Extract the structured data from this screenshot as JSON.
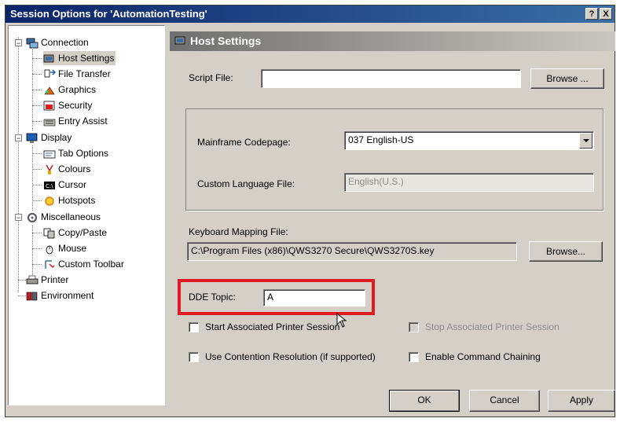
{
  "window": {
    "title": "Session Options for 'AutomationTesting'",
    "help_label": "?",
    "close_label": "X"
  },
  "tree": {
    "connection": "Connection",
    "host_settings": "Host Settings",
    "file_transfer": "File Transfer",
    "graphics": "Graphics",
    "security": "Security",
    "entry_assist": "Entry Assist",
    "display": "Display",
    "tab_options": "Tab Options",
    "colours": "Colours",
    "cursor": "Cursor",
    "hotspots": "Hotspots",
    "miscellaneous": "Miscellaneous",
    "copy_paste": "Copy/Paste",
    "mouse": "Mouse",
    "custom_toolbar": "Custom Toolbar",
    "printer": "Printer",
    "environment": "Environment"
  },
  "panel": {
    "title": "Host Settings",
    "script_file_label": "Script File:",
    "script_file_value": "",
    "browse1_label": "Browse ...",
    "mainframe_codepage_label": "Mainframe Codepage:",
    "mainframe_codepage_value": "037 English-US",
    "custom_language_label": "Custom Language File:",
    "custom_language_value": "English(U.S.)",
    "keyboard_mapping_label": "Keyboard Mapping File:",
    "keyboard_mapping_value": "C:\\Program Files (x86)\\QWS3270 Secure\\QWS3270S.key",
    "browse2_label": "Browse...",
    "dde_topic_label": "DDE Topic:",
    "dde_topic_value": "A",
    "start_printer_label": "Start Associated Printer Session",
    "stop_printer_label": "Stop Associated Printer Session",
    "contention_label": "Use Contention Resolution (if supported)",
    "command_chaining_label": "Enable Command Chaining"
  },
  "buttons": {
    "ok": "OK",
    "cancel": "Cancel",
    "apply": "Apply"
  },
  "colors": {
    "title_bar": "#0a246a",
    "dialog_bg": "#d4d0c8",
    "highlight": "#e01b24"
  }
}
